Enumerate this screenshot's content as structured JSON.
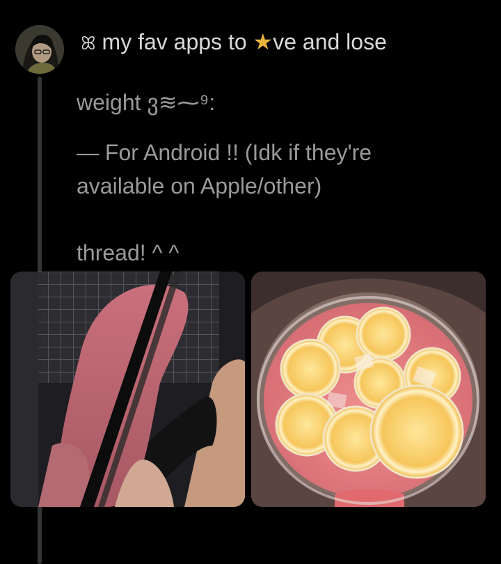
{
  "tweet": {
    "line1_symbol": "ꕤ",
    "line1_a": " my fav apps to ",
    "line1_star": "★",
    "line1_b": "ve and lose",
    "line2": "weight  ვ≋⁓⁹:",
    "line3": "— For Android !! (Idk if they're",
    "line4": "available on Apple/other)",
    "line5": "thread! ^ ^"
  },
  "media": [
    {
      "name": "photo-pink-hair-girl"
    },
    {
      "name": "photo-pink-lemonade-glass"
    }
  ],
  "colors": {
    "background": "#000000",
    "thread_line": "#333639",
    "text_primary": "#d9d9d9",
    "text_dim": "#9a9a9a",
    "star": "#e8b53c"
  }
}
